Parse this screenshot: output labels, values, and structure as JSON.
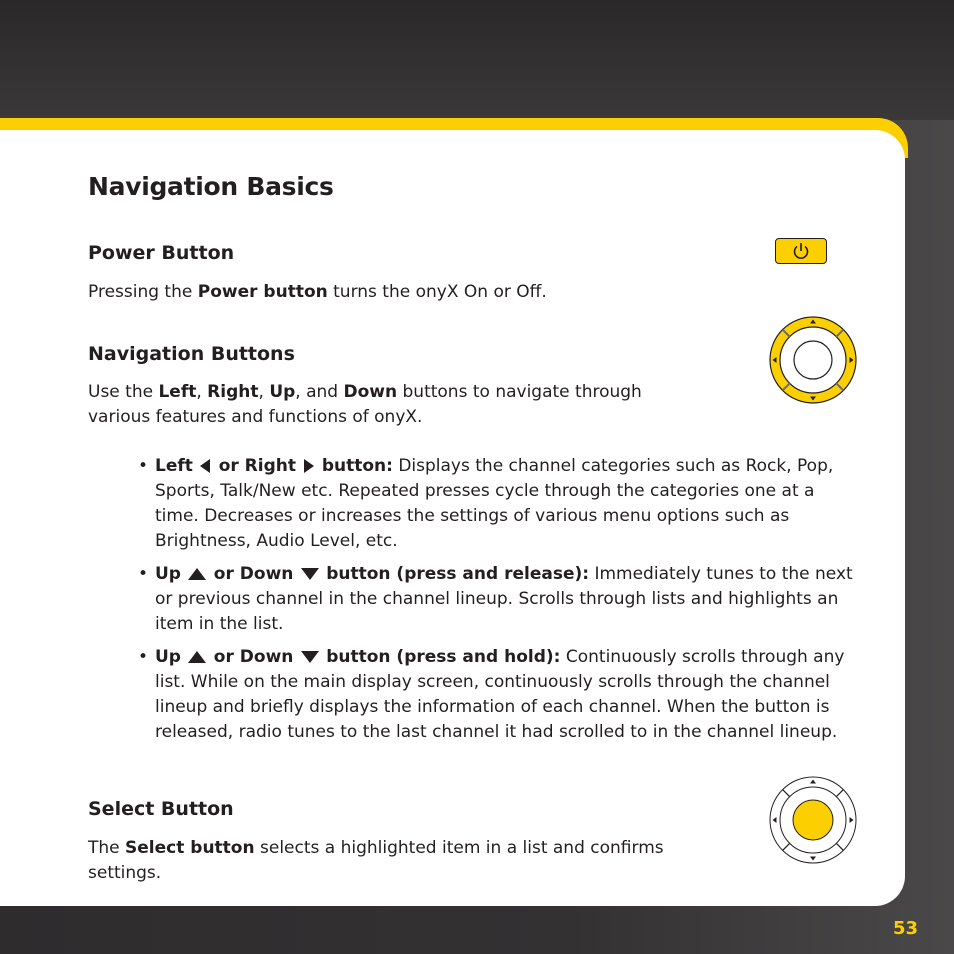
{
  "page": {
    "title": "Navigation Basics",
    "page_number": "53",
    "accent_color": "#fcd000"
  },
  "power": {
    "heading": "Power Button",
    "text_pre": "Pressing the ",
    "text_bold": "Power button",
    "text_post": " turns the onyX On or Off.",
    "icon": "power-icon"
  },
  "navigation": {
    "heading": "Navigation Buttons",
    "intro": {
      "t1": "Use the ",
      "b1": "Left",
      "t2": ", ",
      "b2": "Right",
      "t3": ", ",
      "b3": "Up",
      "t4": ", and ",
      "b4": "Down",
      "t5": " buttons to navigate through",
      "t6": "various features and functions of onyX."
    },
    "bullets": [
      {
        "label_a": "Left",
        "label_b": "or Right",
        "label_c": "button:",
        "text": " Displays the channel categories such as Rock, Pop, Sports, Talk/New etc. Repeated presses cycle through the categories one at a time. Decreases or increases the settings of various menu options such as Brightness, Audio Level, etc."
      },
      {
        "label_a": "Up",
        "label_b": "or Down",
        "label_c": "button (press and release):",
        "text": " Immediately tunes to the next or previous channel in the channel lineup. Scrolls through lists and highlights an item in the list."
      },
      {
        "label_a": "Up",
        "label_b": "or Down",
        "label_c": "button (press and hold):",
        "text": " Continuously scrolls through any list. While on the main display screen, continuously scrolls through the channel lineup and briefly displays the information of each channel. When the button is released, radio tunes to the last channel it had scrolled to in the channel lineup."
      }
    ]
  },
  "select": {
    "heading": "Select Button",
    "text_pre": "The ",
    "text_bold": "Select button",
    "text_post": " selects a highlighted item in a list and confirms",
    "text_line2": "settings."
  }
}
